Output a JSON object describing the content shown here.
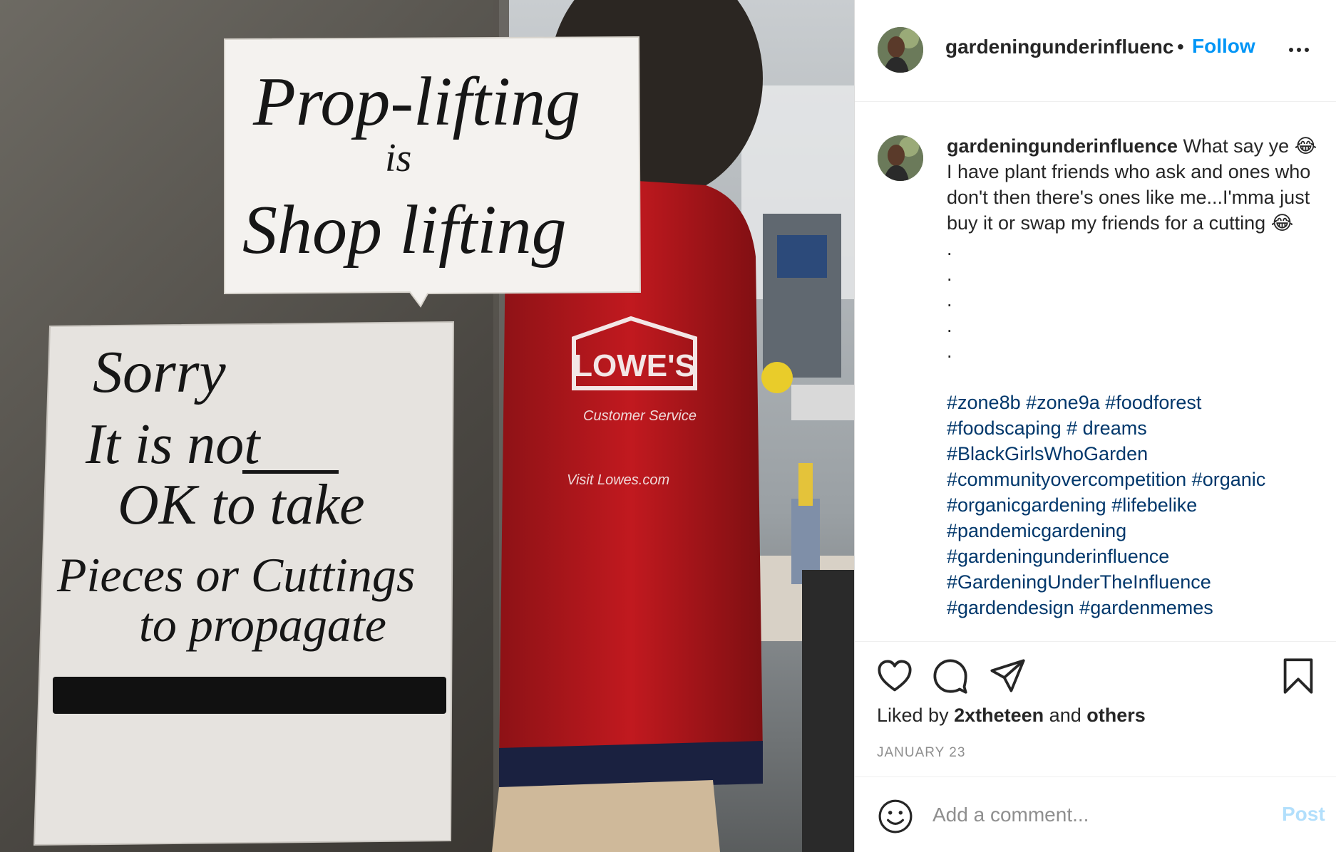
{
  "photo": {
    "sign_top": [
      "Prop-lifting",
      "is",
      "Shop lifting"
    ],
    "sign_bottom": [
      "Sorry",
      "It is not",
      "OK to take",
      "Pieces or Cuttings",
      "to propagate"
    ],
    "vest_logo": "LOWE'S",
    "vest_text_1": "Customer Service",
    "vest_text_2": "Visit Lowes.com"
  },
  "header": {
    "username": "gardeningunderinfluenc",
    "separator": "•",
    "follow_label": "Follow"
  },
  "caption": {
    "username": "gardeningunderinfluence",
    "text": "What say ye 😂 I have plant friends who ask and ones who don't then there's ones like me...I'mma just buy it or swap my friends for a cutting 😂",
    "dots": [
      ".",
      ".",
      ".",
      ".",
      "."
    ],
    "hashtags": [
      "#zone8b",
      "#zone9a",
      "#foodforest",
      "#foodscaping",
      "# dreams",
      "#BlackGirlsWhoGarden",
      "#communityovercompetition",
      "#organic",
      "#organicgardening",
      "#lifebelike",
      "#pandemicgardening",
      "#gardeningunderinfluence",
      "#GardeningUnderTheInfluence",
      "#gardendesign",
      "#gardenmemes"
    ]
  },
  "actions": {
    "icons": [
      "heart-icon",
      "comment-icon",
      "share-icon",
      "bookmark-icon"
    ],
    "liked_prefix": "Liked by",
    "liked_user": "2xtheteen",
    "liked_mid": "and",
    "liked_suffix": "others",
    "date": "JANUARY 23"
  },
  "comment": {
    "placeholder": "Add a comment...",
    "post_label": "Post"
  },
  "colors": {
    "link_blue": "#0095f6",
    "hashtag": "#00376b",
    "post_disabled": "#b2dffc",
    "text": "#262626",
    "muted": "#8e8e8e"
  }
}
